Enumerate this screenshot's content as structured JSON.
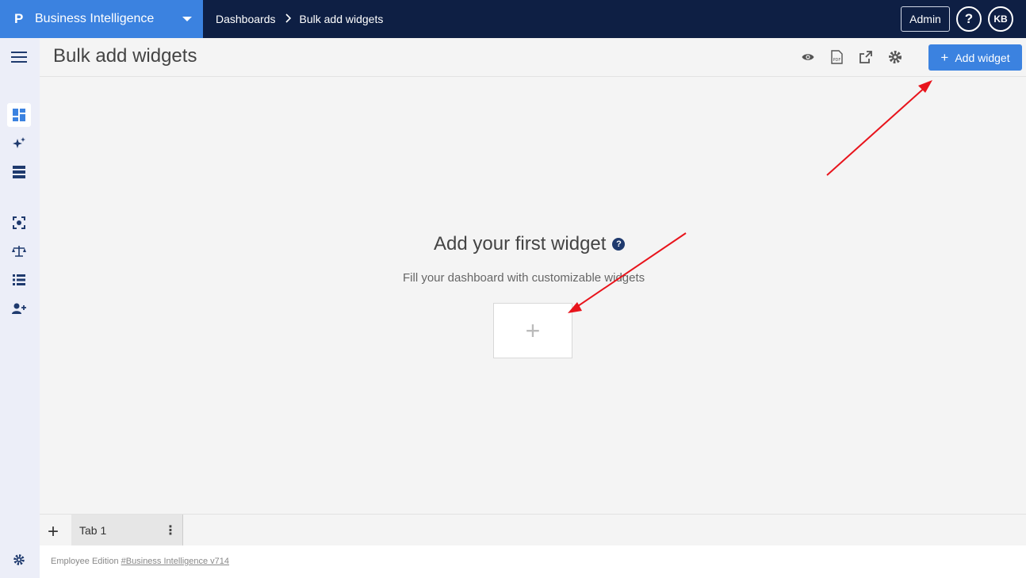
{
  "topbar": {
    "app_logo": "P",
    "app_name": "Business Intelligence",
    "breadcrumb": [
      "Dashboards",
      "Bulk add widgets"
    ],
    "admin_label": "Admin",
    "help_label": "?",
    "avatar_initials": "KB"
  },
  "header": {
    "title": "Bulk add widgets",
    "icons": [
      "eye-icon",
      "pdf-icon",
      "share-icon",
      "gear-icon"
    ],
    "add_widget_label": "Add widget"
  },
  "sidebar": {
    "items": [
      "menu-icon",
      "dashboard-icon",
      "sparkle-icon",
      "table-icon",
      "focus-icon",
      "scale-icon",
      "list-icon",
      "add-user-icon",
      "settings-icon"
    ]
  },
  "empty_state": {
    "title": "Add your first widget",
    "subtitle": "Fill your dashboard with customizable widgets"
  },
  "tabs": [
    {
      "label": "Tab 1"
    }
  ],
  "footer": {
    "edition": "Employee Edition",
    "link": "#Business Intelligence v714"
  },
  "colors": {
    "topbar": "#0e1f44",
    "accent": "#3b82e0",
    "annotation_arrow": "#e8141c"
  }
}
